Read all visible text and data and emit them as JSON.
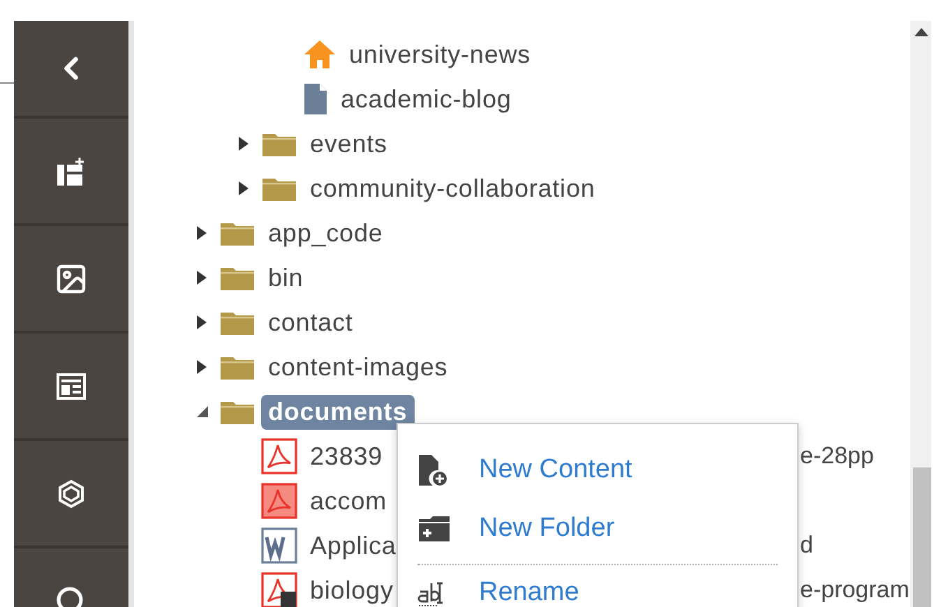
{
  "sidebar": {
    "buttons": [
      {
        "kind": "back"
      },
      {
        "kind": "new-page"
      },
      {
        "kind": "media"
      },
      {
        "kind": "form"
      },
      {
        "kind": "package"
      },
      {
        "kind": "search"
      }
    ]
  },
  "tree": [
    {
      "children": [
        {
          "children": [
            {
              "kind": "home",
              "label": "university-news"
            },
            {
              "kind": "doc",
              "label": "academic-blog"
            }
          ]
        },
        {
          "kind": "folder",
          "label": "events",
          "expanded": false
        },
        {
          "kind": "folder",
          "label": "community-collaboration",
          "expanded": false
        }
      ]
    },
    {
      "kind": "folder",
      "label": "app_code",
      "expanded": false
    },
    {
      "kind": "folder",
      "label": "bin",
      "expanded": false
    },
    {
      "kind": "folder",
      "label": "contact",
      "expanded": false
    },
    {
      "kind": "folder",
      "label": "content-images",
      "expanded": false
    },
    {
      "kind": "folder",
      "label": "documents",
      "expanded": true,
      "selected": true,
      "children": [
        {
          "kind": "pdf",
          "label": "23839",
          "tail": "e-28pp"
        },
        {
          "kind": "pdf-filled",
          "label": "accom"
        },
        {
          "kind": "word",
          "label": "Applica",
          "tail": "d"
        },
        {
          "kind": "pdf-shortcut",
          "label": "biology",
          "tail": "e-program"
        }
      ]
    }
  ],
  "context_menu": [
    {
      "kind": "new-content",
      "label": "New Content",
      "separator_before": false
    },
    {
      "kind": "new-folder",
      "label": "New Folder",
      "separator_before": false
    },
    {
      "kind": "rename",
      "label": "Rename",
      "separator_before": true
    }
  ]
}
